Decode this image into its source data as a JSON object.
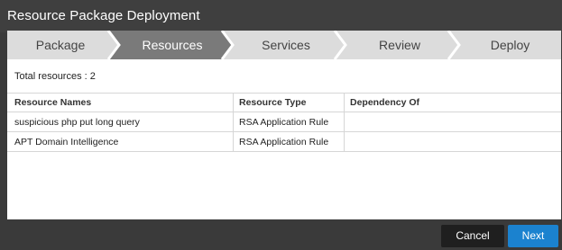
{
  "window": {
    "title": "Resource Package Deployment"
  },
  "wizard": {
    "steps": [
      {
        "label": "Package",
        "active": false
      },
      {
        "label": "Resources",
        "active": true
      },
      {
        "label": "Services",
        "active": false
      },
      {
        "label": "Review",
        "active": false
      },
      {
        "label": "Deploy",
        "active": false
      }
    ]
  },
  "summary": {
    "total_label": "Total resources : 2"
  },
  "table": {
    "columns": [
      "Resource Names",
      "Resource Type",
      "Dependency Of"
    ],
    "rows": [
      [
        "suspicious php put long query",
        "RSA Application Rule",
        ""
      ],
      [
        "APT Domain Intelligence",
        "RSA Application Rule",
        ""
      ]
    ]
  },
  "footer": {
    "cancel_label": "Cancel",
    "next_label": "Next"
  },
  "colors": {
    "accent": "#1b82cf",
    "active_step": "#7a7a7a",
    "inactive_step": "#dcdcdc"
  }
}
